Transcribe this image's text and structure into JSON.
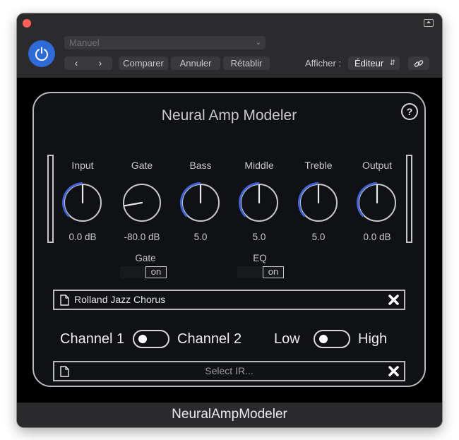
{
  "host": {
    "preset": "Manuel",
    "compare_label": "Comparer",
    "undo_label": "Annuler",
    "redo_label": "Rétablir",
    "show_label": "Afficher :",
    "view_value": "Éditeur"
  },
  "plugin": {
    "title": "Neural Amp Modeler",
    "knobs": [
      {
        "name": "Input",
        "value": "0.0 dB",
        "level": 0.5
      },
      {
        "name": "Gate",
        "value": "-80.0 dB",
        "level": 0.0
      },
      {
        "name": "Bass",
        "value": "5.0",
        "level": 0.5
      },
      {
        "name": "Middle",
        "value": "5.0",
        "level": 0.5
      },
      {
        "name": "Treble",
        "value": "5.0",
        "level": 0.5
      },
      {
        "name": "Output",
        "value": "0.0 dB",
        "level": 0.5
      }
    ],
    "toggles": [
      {
        "label": "Gate",
        "state": "on"
      },
      {
        "label": "EQ",
        "state": "on"
      }
    ],
    "model_file": "Rolland Jazz Chorus",
    "ir_placeholder": "Select IR...",
    "channel_switch": {
      "left": "Channel 1",
      "right": "Channel 2",
      "selected": "Channel 1"
    },
    "gain_switch": {
      "left": "Low",
      "right": "High",
      "selected": "Low"
    },
    "accent_color": "#3f63d6"
  },
  "footer": "NeuralAmpModeler"
}
